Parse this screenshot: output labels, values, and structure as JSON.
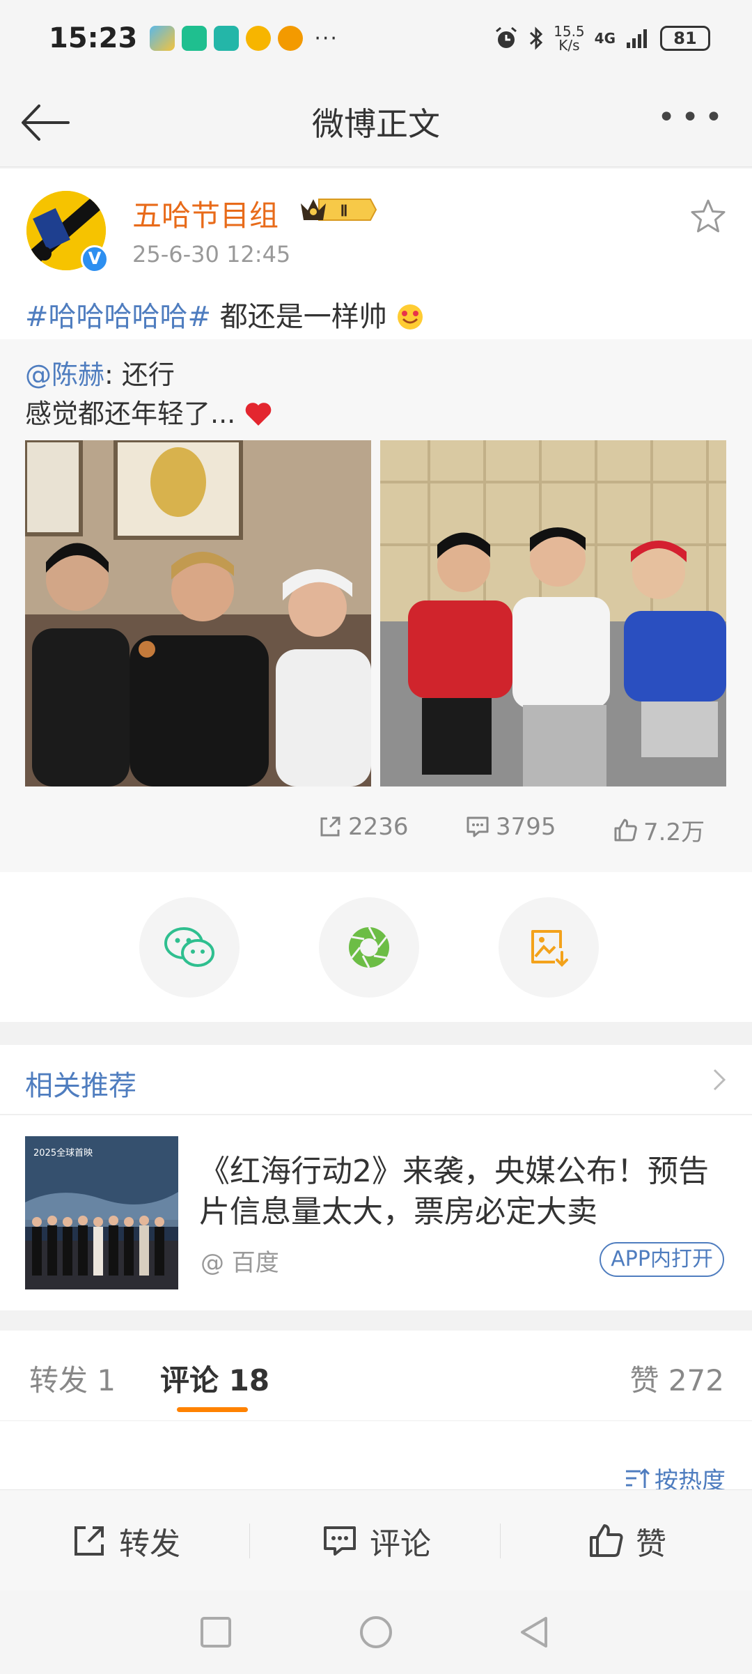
{
  "status_bar": {
    "time": "15:23",
    "app_icons": [
      "game-app-icon",
      "sport-app-icon",
      "sport-app-icon",
      "weibo-app-icon",
      "weibo-app-icon"
    ],
    "more": "···",
    "net_speed_value": "15.5",
    "net_speed_unit": "K/s",
    "network": "4G",
    "battery": "81"
  },
  "nav": {
    "title": "微博正文"
  },
  "post": {
    "author": "五哈节目组",
    "badge": "Ⅱ",
    "time": "25-6-30 12:45",
    "topic": "#哈哈哈哈哈#",
    "text": " 都还是一样帅"
  },
  "repost": {
    "mention": "@陈赫",
    "line1_rest": ": 还行",
    "line2": "感觉都还年轻了...",
    "stats": {
      "reposts": "2236",
      "comments": "3795",
      "likes": "7.2万"
    }
  },
  "related": {
    "title": "相关推荐",
    "headline": "《红海行动2》来袭，央媒公布！预告片信息量太大，票房必定大卖",
    "source": "@ 百度",
    "open_label": "APP内打开",
    "thumb_caption": "2025全球首映"
  },
  "tabs": {
    "repost": "转发 1",
    "comment": "评论 18",
    "like": "赞 272"
  },
  "sort": {
    "label": "按热度"
  },
  "actions": {
    "repost": "转发",
    "comment": "评论",
    "like": "赞"
  },
  "colors": {
    "link_blue": "#4f7dbf",
    "author_orange": "#e86b1a",
    "tab_accent": "#ff8200"
  }
}
